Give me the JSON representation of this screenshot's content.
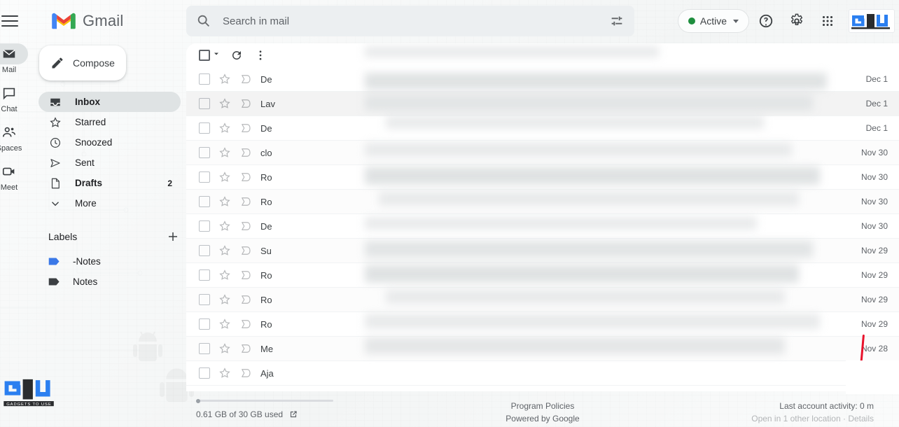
{
  "app": {
    "brand_name": "Gmail",
    "menu_icon": "hamburger-icon",
    "logo_icon": "gmail-m-logo"
  },
  "search": {
    "placeholder": "Search in mail",
    "value": "",
    "search_icon": "search-icon",
    "filter_icon": "tune-options-icon"
  },
  "header": {
    "status_label": "Active",
    "status_color": "#1e8e3e",
    "help_icon": "help-question-icon",
    "settings_icon": "gear-icon",
    "apps_icon": "apps-grid-icon",
    "watermark_logo": "gadgets-to-use-logo"
  },
  "rail": {
    "items": [
      {
        "label": "Mail",
        "icon": "mail-envelope-icon",
        "active": true
      },
      {
        "label": "Chat",
        "icon": "chat-bubble-icon",
        "active": false
      },
      {
        "label": "Spaces",
        "icon": "spaces-people-icon",
        "active": false
      },
      {
        "label": "Meet",
        "icon": "meet-video-camera-icon",
        "active": false
      }
    ]
  },
  "sidebar": {
    "compose_label": "Compose",
    "compose_icon": "pencil-icon",
    "items": [
      {
        "label": "Inbox",
        "icon": "inbox-tray-icon",
        "count": "",
        "active": true,
        "bold": true
      },
      {
        "label": "Starred",
        "icon": "star-outline-icon",
        "count": "",
        "active": false,
        "bold": false
      },
      {
        "label": "Snoozed",
        "icon": "clock-icon",
        "count": "",
        "active": false,
        "bold": false
      },
      {
        "label": "Sent",
        "icon": "send-paper-plane-icon",
        "count": "",
        "active": false,
        "bold": false
      },
      {
        "label": "Drafts",
        "icon": "draft-document-icon",
        "count": "2",
        "active": false,
        "bold": true
      },
      {
        "label": "More",
        "icon": "chevron-down-icon",
        "count": "",
        "active": false,
        "bold": false
      }
    ],
    "labels_title": "Labels",
    "add_label_icon": "plus-icon",
    "labels": [
      {
        "name": "-Notes",
        "color": "#3b78e7"
      },
      {
        "name": "Notes",
        "color": "#3c4043"
      }
    ]
  },
  "toolbar": {
    "select_all_icon": "checkbox-icon",
    "select_caret_icon": "chevron-down-icon",
    "refresh_icon": "refresh-icon",
    "more_icon": "more-vertical-icon"
  },
  "mail_list": {
    "rows": [
      {
        "sender": "De",
        "date": "Dec 1",
        "selected": false
      },
      {
        "sender": "Lav",
        "date": "Dec 1",
        "selected": true
      },
      {
        "sender": "De",
        "date": "Dec 1",
        "selected": false
      },
      {
        "sender": "clo",
        "date": "Nov 30",
        "selected": false
      },
      {
        "sender": "Ro",
        "date": "Nov 30",
        "selected": false
      },
      {
        "sender": "Ro",
        "date": "Nov 30",
        "selected": false
      },
      {
        "sender": "De",
        "date": "Nov 30",
        "selected": false
      },
      {
        "sender": "Su",
        "date": "Nov 29",
        "selected": false
      },
      {
        "sender": "Ro",
        "date": "Nov 29",
        "selected": false
      },
      {
        "sender": "Ro",
        "date": "Nov 29",
        "selected": false
      },
      {
        "sender": "Ro",
        "date": "Nov 29",
        "selected": false
      },
      {
        "sender": "Me",
        "date": "Nov 28",
        "selected": false
      },
      {
        "sender": "Aja",
        "date": "",
        "selected": false
      }
    ]
  },
  "footer": {
    "storage_text": "0.61 GB of 30 GB used",
    "storage_link_icon": "open-external-icon",
    "program_policies": "Program Policies",
    "powered_by": "Powered by Google",
    "last_activity": "Last account activity: 0 m",
    "other_location": "Open in 1 other location · Details"
  }
}
